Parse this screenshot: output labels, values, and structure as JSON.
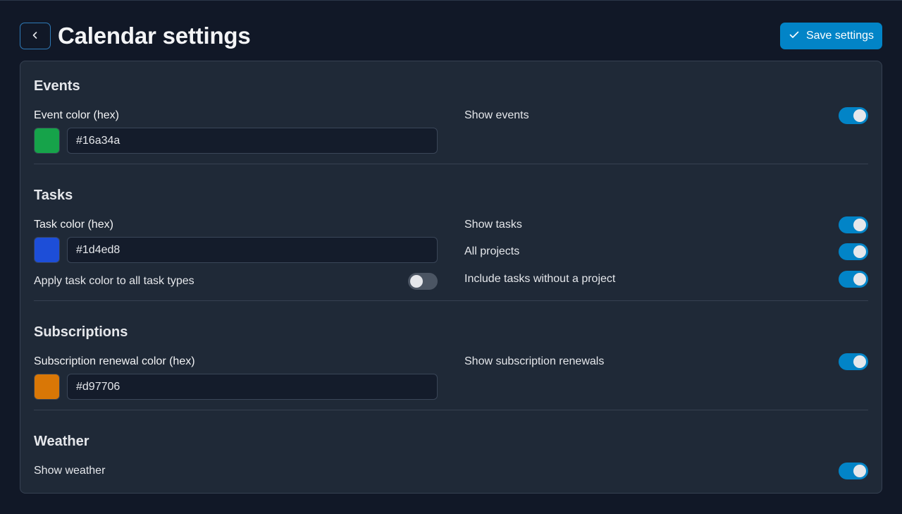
{
  "header": {
    "title": "Calendar settings",
    "save_label": "Save settings"
  },
  "colors": {
    "accent": "#0284c7",
    "panel_bg": "#1f2937",
    "page_bg": "#111827",
    "toggle_off": "#4b5563"
  },
  "events": {
    "title": "Events",
    "color_label": "Event color (hex)",
    "color_value": "#16a34a",
    "show_label": "Show events",
    "show_on": true
  },
  "tasks": {
    "title": "Tasks",
    "color_label": "Task color (hex)",
    "color_value": "#1d4ed8",
    "apply_label": "Apply task color to all task types",
    "apply_on": false,
    "show_label": "Show tasks",
    "show_on": true,
    "all_projects_label": "All projects",
    "all_projects_on": true,
    "include_label": "Include tasks without a project",
    "include_on": true
  },
  "subscriptions": {
    "title": "Subscriptions",
    "color_label": "Subscription renewal color (hex)",
    "color_value": "#d97706",
    "show_label": "Show subscription renewals",
    "show_on": true
  },
  "weather": {
    "title": "Weather",
    "show_label": "Show weather",
    "show_on": true
  },
  "icons": {
    "back": "chevron-left-icon",
    "save": "check-icon"
  }
}
